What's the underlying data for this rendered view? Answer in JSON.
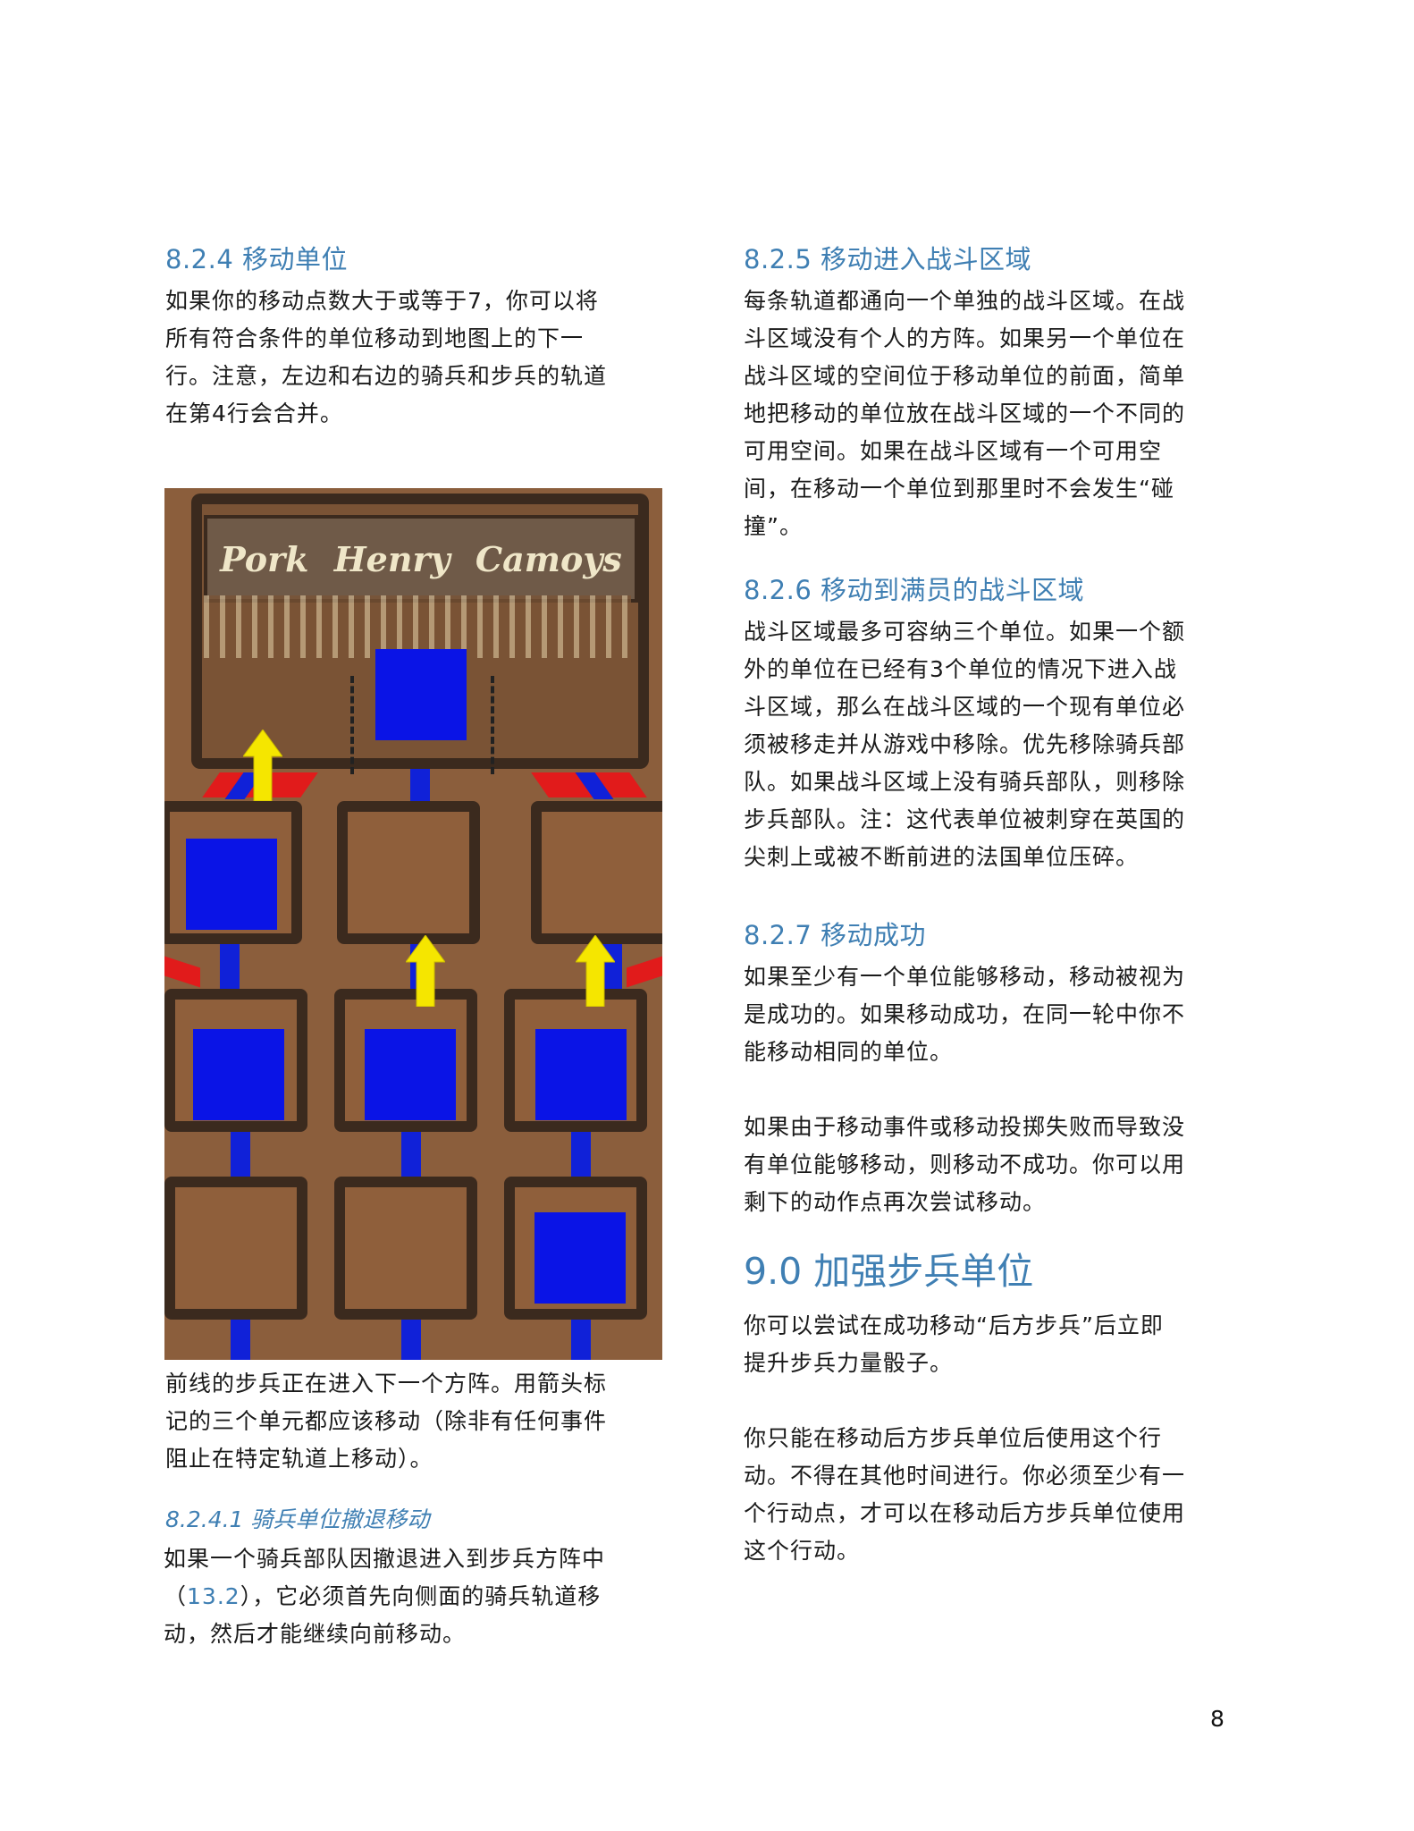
{
  "left": {
    "s824_title": "8.2.4 移动单位",
    "s824_lines": [
      "如果你的移动点数大于或等于7，你可以将",
      "所有符合条件的单位移动到地图上的下一",
      "行。注意，左边和右边的骑兵和步兵的轨道",
      "在第4行会合并。"
    ],
    "board_labels": [
      "Pork",
      "Henry",
      "Camoys"
    ],
    "caption_lines": [
      "前线的步兵正在进入下一个方阵。用箭头标",
      "记的三个单元都应该移动（除非有任何事件",
      "阻止在特定轨道上移动）。"
    ],
    "s8241_title": "8.2.4.1 骑兵单位撤退移动",
    "s8241_line1": "如果一个骑兵部队因撤退进入到步兵方阵中",
    "s8241_paren_open": "（",
    "s8241_ref": "13.2",
    "s8241_line2_rest": "），它必须首先向侧面的骑兵轨道移",
    "s8241_line3": "动，然后才能继续向前移动。"
  },
  "right": {
    "s825_title": "8.2.5 移动进入战斗区域",
    "s825_lines": [
      "每条轨道都通向一个单独的战斗区域。在战",
      "斗区域没有个人的方阵。如果另一个单位在",
      "战斗区域的空间位于移动单位的前面，简单",
      "地把移动的单位放在战斗区域的一个不同的",
      "可用空间。如果在战斗区域有一个可用空",
      "间，在移动一个单位到那里时不会发生“碰",
      "撞”。"
    ],
    "s826_title": "8.2.6 移动到满员的战斗区域",
    "s826_lines": [
      " 战斗区域最多可容纳三个单位。如果一个额",
      "外的单位在已经有3个单位的情况下进入战",
      "斗区域，那么在战斗区域的一个现有单位必",
      "须被移走并从游戏中移除。优先移除骑兵部",
      "队。如果战斗区域上没有骑兵部队，则移除",
      "步兵部队。注：这代表单位被刺穿在英国的",
      "尖刺上或被不断前进的法国单位压碎。"
    ],
    "s827_title": "8.2.7 移动成功",
    "s827_p1": [
      "如果至少有一个单位能够移动，移动被视为",
      "是成功的。如果移动成功，在同一轮中你不",
      "能移动相同的单位。"
    ],
    "s827_p2": [
      "如果由于移动事件或移动投掷失败而导致没",
      "有单位能够移动，则移动不成功。你可以用",
      "剩下的动作点再次尝试移动。"
    ],
    "s90_title": "9.0 加强步兵单位",
    "s90_p1": [
      "你可以尝试在成功移动“后方步兵”后立即",
      "提升步兵力量骰子。"
    ],
    "s90_p2": [
      "你只能在移动后方步兵单位后使用这个行",
      "动。不得在其他时间进行。你必须至少有一",
      "个行动点，才可以在移动后方步兵单位使用",
      "这个行动。"
    ]
  },
  "page_number": "8",
  "colors": {
    "heading": "#3f7fb3",
    "unit_blue": "#0a14e6",
    "arrow_yellow": "#f5e600",
    "lane_red": "#e11b1b"
  }
}
